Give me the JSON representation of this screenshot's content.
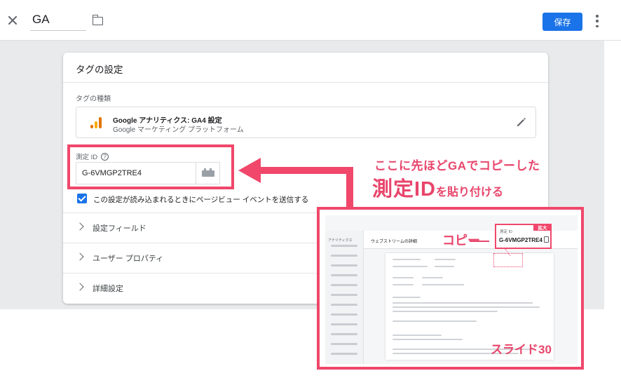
{
  "header": {
    "tag_name": "GA",
    "save_label": "保存"
  },
  "card": {
    "title": "タグの設定",
    "tag_type_label": "タグの種類",
    "tag_type_name": "Google アナリティクス: GA4 設定",
    "tag_type_sub": "Google マーケティング プラットフォーム",
    "measurement_label": "測定 ID",
    "measurement_value": "G-6VMGP2TRE4",
    "checkbox_label": "この設定が読み込まれるときにページビュー イベントを送信する",
    "checkbox_checked": true,
    "sections": [
      {
        "label": "設定フィールド"
      },
      {
        "label": "ユーザー プロパティ"
      },
      {
        "label": "詳細設定"
      }
    ]
  },
  "annotation": {
    "line1": "ここに先ほどGAでコピーした",
    "line2_big": "測定ID",
    "line2_small": "を貼り付ける",
    "accent_color": "#e8456b"
  },
  "inset": {
    "analytics_label": "アナリティクス",
    "stream_title": "ウェブストリームの詳細",
    "copy_label": "コピー",
    "zoom_badge": "拡大",
    "zoom_label": "測定 ID",
    "zoom_value": "G-6VMGP2TRE4",
    "slide_label": "スライド30"
  },
  "icons": {
    "close": "close-icon",
    "folder": "folder-icon",
    "more": "more-vert-icon",
    "analytics_logo": "analytics-logo-icon",
    "edit": "pencil-icon",
    "help": "help-icon",
    "variable": "variable-icon",
    "chevron": "chevron-right-icon"
  }
}
